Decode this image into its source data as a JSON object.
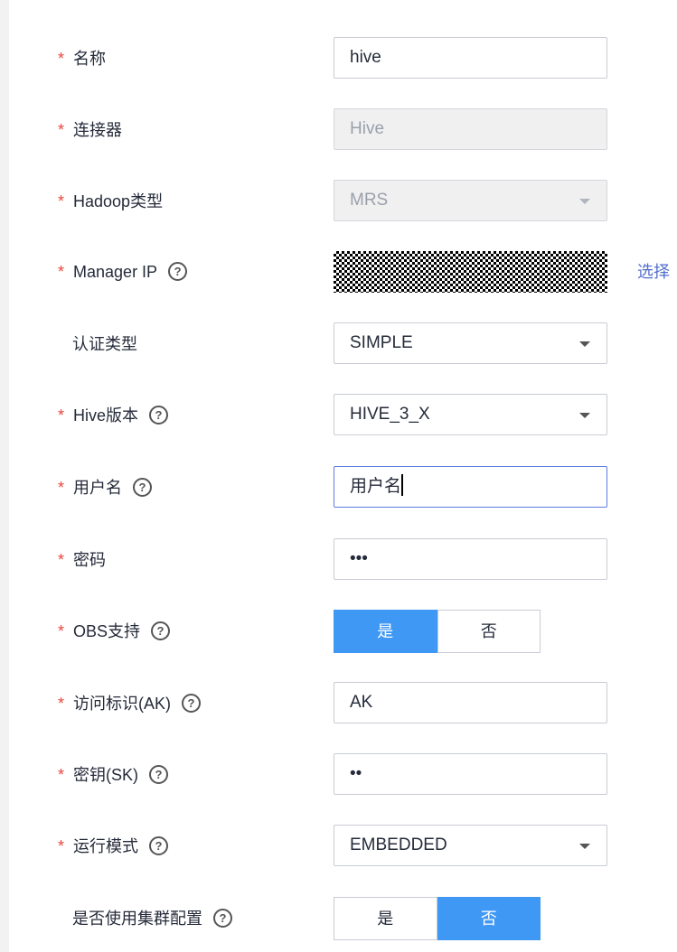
{
  "form": {
    "name": {
      "label": "名称",
      "value": "hive"
    },
    "connector": {
      "label": "连接器",
      "value": "Hive"
    },
    "hadoop_type": {
      "label": "Hadoop类型",
      "value": "MRS"
    },
    "manager_ip": {
      "label": "Manager IP",
      "select_link": "选择"
    },
    "auth_type": {
      "label": "认证类型",
      "value": "SIMPLE"
    },
    "hive_version": {
      "label": "Hive版本",
      "value": "HIVE_3_X"
    },
    "username": {
      "label": "用户名",
      "value": "用户名"
    },
    "password": {
      "label": "密码",
      "value": "•••"
    },
    "obs_support": {
      "label": "OBS支持",
      "options": [
        "是",
        "否"
      ],
      "selected": "是"
    },
    "access_key": {
      "label": "访问标识(AK)",
      "value": "AK"
    },
    "secret_key": {
      "label": "密钥(SK)",
      "value": "••"
    },
    "run_mode": {
      "label": "运行模式",
      "value": "EMBEDDED"
    },
    "use_cluster_config": {
      "label": "是否使用集群配置",
      "options": [
        "是",
        "否"
      ],
      "selected": "否"
    }
  },
  "required_mark": "*",
  "help_icon_glyph": "?",
  "colors": {
    "accent": "#3f98f4",
    "required": "#e8473b",
    "link": "#526ecc"
  }
}
